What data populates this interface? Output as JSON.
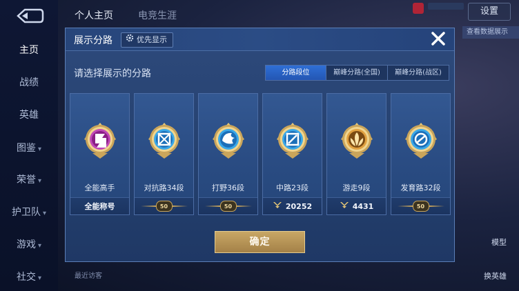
{
  "background": {
    "sidebar_items": [
      {
        "label": "主页",
        "chevron": false,
        "active": true
      },
      {
        "label": "战绩",
        "chevron": false,
        "active": false
      },
      {
        "label": "英雄",
        "chevron": false,
        "active": false
      },
      {
        "label": "图鉴",
        "chevron": true,
        "active": false
      },
      {
        "label": "荣誉",
        "chevron": true,
        "active": false
      },
      {
        "label": "护卫队",
        "chevron": true,
        "active": false
      },
      {
        "label": "游戏",
        "chevron": true,
        "active": false
      },
      {
        "label": "社交",
        "chevron": true,
        "active": false
      }
    ],
    "top_tabs": [
      "个人主页",
      "电竞生涯"
    ],
    "settings_label": "设置",
    "right_button_label": "查看数据展示",
    "right_bottom_labels": [
      "模型",
      "换英雄"
    ],
    "bottom_visit_text": "最近访客"
  },
  "modal": {
    "title": "展示分路",
    "priority_label": "优先显示",
    "subtitle": "请选择展示的分路",
    "tabs": [
      {
        "label": "分路段位",
        "active": true
      },
      {
        "label": "巅峰分路(全国)",
        "active": false
      },
      {
        "label": "巅峰分路(战区)",
        "active": false
      }
    ],
    "cards": [
      {
        "label": "全能高手",
        "footer_type": "text",
        "footer_text": "全能称号",
        "badge_icon": "all-round-badge-icon"
      },
      {
        "label": "对抗路34段",
        "footer_type": "star",
        "footer_text": "50",
        "badge_icon": "clash-lane-badge-icon"
      },
      {
        "label": "打野36段",
        "footer_type": "star",
        "footer_text": "50",
        "badge_icon": "jungle-badge-icon"
      },
      {
        "label": "中路23段",
        "footer_type": "points",
        "footer_text": "20252",
        "badge_icon": "mid-lane-badge-icon"
      },
      {
        "label": "游走9段",
        "footer_type": "points",
        "footer_text": "4431",
        "badge_icon": "roam-badge-icon"
      },
      {
        "label": "发育路32段",
        "footer_type": "star",
        "footer_text": "50",
        "badge_icon": "farm-lane-badge-icon"
      }
    ],
    "confirm_label": "确定"
  },
  "colors": {
    "accent": "#2f6fd6",
    "gold": "#c9a55a",
    "modal_bg": "#2a4c83"
  }
}
